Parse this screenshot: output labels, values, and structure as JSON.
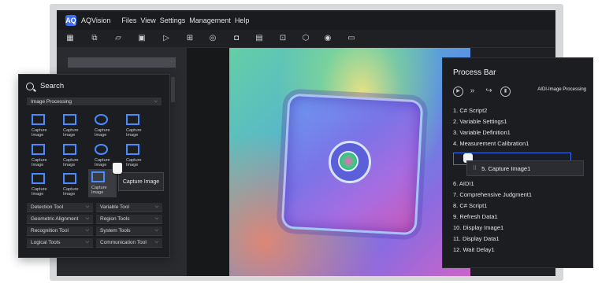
{
  "app": {
    "logo_text": "AQ",
    "title": "AQVision"
  },
  "menu": [
    "Files",
    "View",
    "Settings",
    "Management",
    "Help"
  ],
  "toolbar_icons": [
    "grid-icon",
    "layers-icon",
    "folder-open-icon",
    "save-icon",
    "play-icon",
    "steps-icon",
    "record-icon",
    "camera-icon",
    "calendar-icon",
    "roi-icon",
    "cube-icon",
    "target-icon",
    "image-strip-icon"
  ],
  "search": {
    "title": "Search",
    "category": "Image Processing",
    "tools": [
      {
        "label": "Capture Image",
        "icon": "camera-icon"
      },
      {
        "label": "Capture Image",
        "icon": "image-icon"
      },
      {
        "label": "Capture Image",
        "icon": "arrow-circle-icon"
      },
      {
        "label": "Capture Image",
        "icon": "camera-icon"
      },
      {
        "label": "Capture Image",
        "icon": "crop-icon"
      },
      {
        "label": "Capture Image",
        "icon": "bracket-icon"
      },
      {
        "label": "Capture Image",
        "icon": "target-icon"
      },
      {
        "label": "Capture Image",
        "icon": "image-icon"
      },
      {
        "label": "Capture Image",
        "icon": "crossed-box-icon"
      },
      {
        "label": "Capture Image",
        "icon": "film-icon"
      },
      {
        "label": "Capture Image",
        "icon": "film-icon"
      }
    ],
    "tooltip": "Capture Image",
    "dropdowns": [
      "Detection Tool",
      "Variable Tool",
      "Geometric Alignment",
      "Region Tools",
      "Recognition Tool",
      "System Tools",
      "Logical Tools",
      "Communication Tool"
    ]
  },
  "process_bar": {
    "title": "Process Bar",
    "module": "AIDI-Image Processing",
    "steps": [
      "1.  C# Script2",
      "2.  Variable Settings1",
      "3.  Variable Definition1",
      "4.  Measurement Calibration1",
      "6.  AIDI1",
      "7.  Comprehensive Judgment1",
      "8.  C# Script1",
      "9.  Refresh Data1",
      "10.  Display Image1",
      "11.  Display Data1",
      "12.  Wait Delay1"
    ],
    "dragged_step": "5.  Capture Image1"
  },
  "colors": {
    "accent": "#3d6df2",
    "icon_blue": "#4a8cff",
    "panel": "#1c1d20"
  }
}
